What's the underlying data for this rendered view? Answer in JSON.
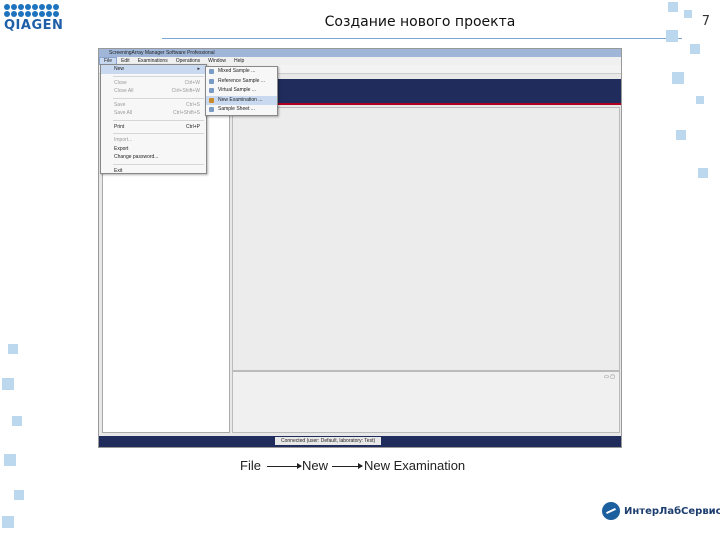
{
  "slide": {
    "title": "Создание нового проекта",
    "page_number": "7",
    "logo_text": "QIAGEN",
    "brand_name": "ИнтерЛабСервис"
  },
  "app": {
    "window_title": "ScreeningArray Manager Software Professional",
    "menubar": [
      "File",
      "Edit",
      "Examinations",
      "Operations",
      "Window",
      "Help"
    ],
    "file_menu": {
      "items": [
        {
          "label": "New",
          "shortcut": "",
          "enabled": true,
          "highlighted": true,
          "submenu": true
        },
        {
          "label": "Close",
          "shortcut": "Ctrl+W",
          "enabled": false
        },
        {
          "label": "Close All",
          "shortcut": "Ctrl+Shift+W",
          "enabled": false
        },
        {
          "label": "Save",
          "shortcut": "Ctrl+S",
          "enabled": false
        },
        {
          "label": "Save All",
          "shortcut": "Ctrl+Shift+S",
          "enabled": false
        },
        {
          "label": "Print",
          "shortcut": "Ctrl+P",
          "enabled": true
        },
        {
          "label": "Import...",
          "shortcut": "",
          "enabled": false
        },
        {
          "label": "Export",
          "shortcut": "",
          "enabled": true
        },
        {
          "label": "Change password...",
          "shortcut": "",
          "enabled": true
        },
        {
          "label": "Exit",
          "shortcut": "",
          "enabled": true
        }
      ]
    },
    "new_submenu": {
      "items": [
        {
          "label": "Mixed Sample ...",
          "icon": "sample-icon",
          "highlighted": false
        },
        {
          "label": "Reference Sample ...",
          "icon": "reference-icon",
          "highlighted": false
        },
        {
          "label": "Virtual Sample ...",
          "icon": "virtual-icon",
          "highlighted": false
        },
        {
          "label": "New Examination ...",
          "icon": "examination-icon",
          "highlighted": true
        },
        {
          "label": "Sample Sheet ...",
          "icon": "sheet-icon",
          "highlighted": false
        }
      ]
    },
    "status_text": "Connected (user: Default, laboratory: Test)",
    "panel_controls": "▭ ▢"
  },
  "path_caption": {
    "steps": [
      "File",
      "New",
      "New Examination"
    ]
  }
}
